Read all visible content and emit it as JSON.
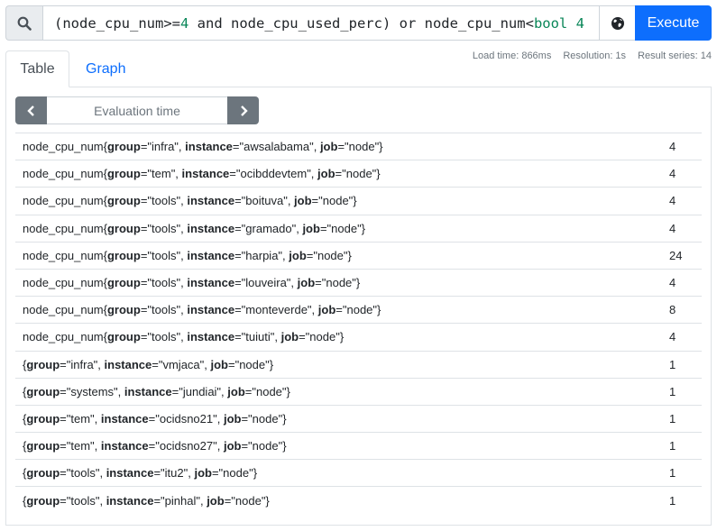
{
  "query": {
    "search_icon": "search-icon",
    "expression_parts": [
      {
        "text": "(node_cpu_num>=",
        "type": "text"
      },
      {
        "text": "4",
        "type": "num"
      },
      {
        "text": " and node_cpu_used_perc) or node_cpu_num<",
        "type": "text"
      },
      {
        "text": "bool 4",
        "type": "num"
      }
    ],
    "metrics_icon": "globe-icon",
    "execute_label": "Execute"
  },
  "tabs": [
    {
      "label": "Table",
      "active": true
    },
    {
      "label": "Graph",
      "active": false
    }
  ],
  "stats": {
    "load_time": "Load time: 866ms",
    "resolution": "Resolution: 1s",
    "result_series": "Result series: 14"
  },
  "eval_time": {
    "placeholder": "Evaluation time",
    "prev_icon": "chevron-left-icon",
    "next_icon": "chevron-right-icon"
  },
  "results": [
    {
      "metric": "node_cpu_num",
      "group": "infra",
      "instance": "awsalabama",
      "job": "node",
      "value": "4"
    },
    {
      "metric": "node_cpu_num",
      "group": "tem",
      "instance": "ocibddevtem",
      "job": "node",
      "value": "4"
    },
    {
      "metric": "node_cpu_num",
      "group": "tools",
      "instance": "boituva",
      "job": "node",
      "value": "4"
    },
    {
      "metric": "node_cpu_num",
      "group": "tools",
      "instance": "gramado",
      "job": "node",
      "value": "4"
    },
    {
      "metric": "node_cpu_num",
      "group": "tools",
      "instance": "harpia",
      "job": "node",
      "value": "24"
    },
    {
      "metric": "node_cpu_num",
      "group": "tools",
      "instance": "louveira",
      "job": "node",
      "value": "4"
    },
    {
      "metric": "node_cpu_num",
      "group": "tools",
      "instance": "monteverde",
      "job": "node",
      "value": "8"
    },
    {
      "metric": "node_cpu_num",
      "group": "tools",
      "instance": "tuiuti",
      "job": "node",
      "value": "4"
    },
    {
      "metric": "",
      "group": "infra",
      "instance": "vmjaca",
      "job": "node",
      "value": "1"
    },
    {
      "metric": "",
      "group": "systems",
      "instance": "jundiai",
      "job": "node",
      "value": "1"
    },
    {
      "metric": "",
      "group": "tem",
      "instance": "ocidsno21",
      "job": "node",
      "value": "1"
    },
    {
      "metric": "",
      "group": "tem",
      "instance": "ocidsno27",
      "job": "node",
      "value": "1"
    },
    {
      "metric": "",
      "group": "tools",
      "instance": "itu2",
      "job": "node",
      "value": "1"
    },
    {
      "metric": "",
      "group": "tools",
      "instance": "pinhal",
      "job": "node",
      "value": "1"
    }
  ]
}
